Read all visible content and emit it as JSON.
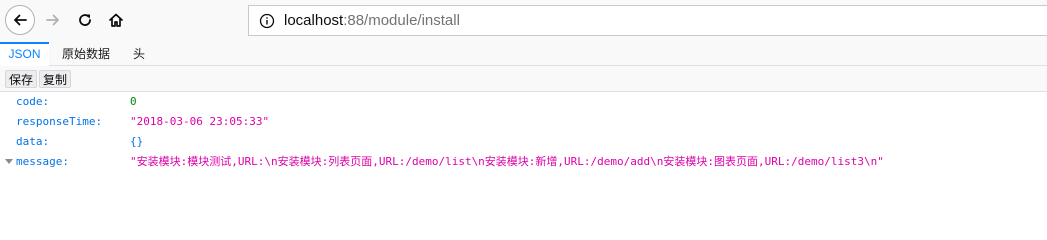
{
  "browser": {
    "url_host": "localhost",
    "url_rest": ":88/module/install",
    "icons": {
      "back": "back-arrow-icon",
      "forward": "forward-arrow-icon",
      "reload": "reload-icon",
      "home": "home-icon",
      "info": "info-icon"
    }
  },
  "tabs": [
    {
      "label": "JSON",
      "active": true
    },
    {
      "label": "原始数据",
      "active": false
    },
    {
      "label": "头",
      "active": false
    }
  ],
  "actions": {
    "save_label": "保存",
    "copy_label": "复制"
  },
  "json": {
    "rows": [
      {
        "key": "code:",
        "value": "0",
        "type": "number"
      },
      {
        "key": "responseTime:",
        "value": "\"2018-03-06 23:05:33\"",
        "type": "string"
      },
      {
        "key": "data:",
        "value": "{}",
        "type": "object"
      },
      {
        "key": "message:",
        "value": "\"安装模块:模块测试,URL:\\n安装模块:列表页面,URL:/demo/list\\n安装模块:新增,URL:/demo/add\\n安装模块:图表页面,URL:/demo/list3\\n\"",
        "type": "string",
        "expanded": true
      }
    ]
  },
  "colors": {
    "accent": "#0a84ff",
    "key": "#0074e8",
    "string": "#dd00a9",
    "number": "#058b00"
  }
}
